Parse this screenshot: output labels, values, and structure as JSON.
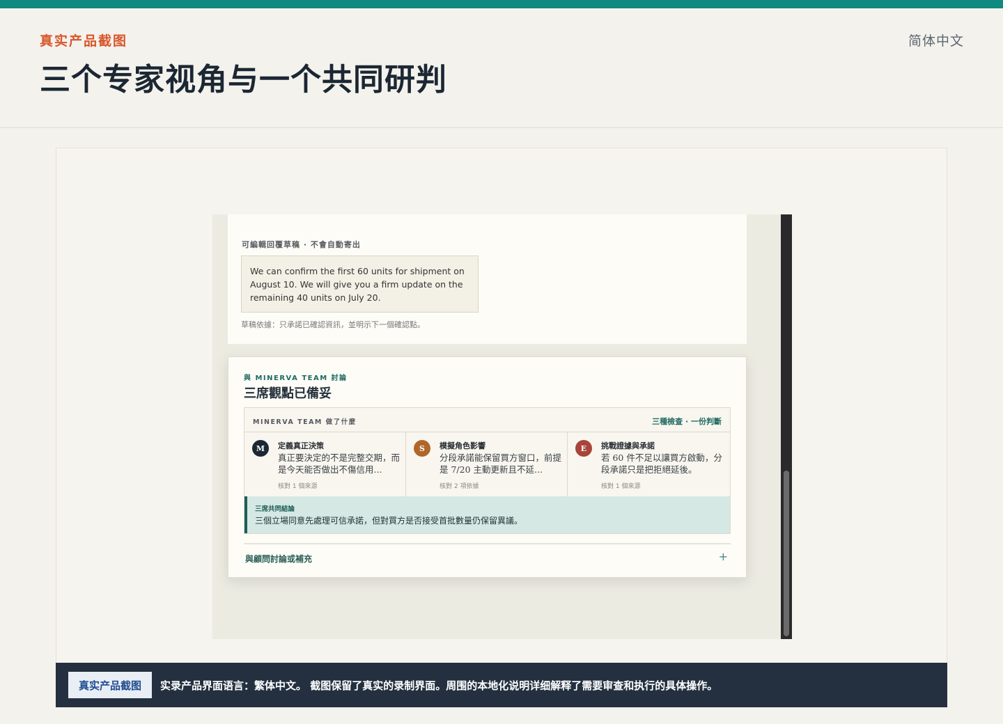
{
  "header": {
    "eyebrow": "真实产品截图",
    "title": "三个专家视角与一个共同研判",
    "language_switch": "简体中文"
  },
  "screenshot": {
    "draft_card": {
      "label": "可編輯回覆草稿 · 不會自動寄出",
      "draft_text": "We can confirm the first 60 units for shipment on August 10. We will give you a firm update on the remaining 40 units on July 20.",
      "note": "草稿依據：只承諾已確認資訊，並明示下一個確認點。"
    },
    "team_card": {
      "eyebrow": "與 MINERVA TEAM 討論",
      "title": "三席觀點已備妥",
      "panel_left": "MINERVA TEAM 做了什麼",
      "panel_right": "三種檢查 · 一份判斷",
      "perspectives": [
        {
          "initial": "M",
          "color": "#1c2733",
          "title": "定義真正決策",
          "body": "真正要決定的不是完整交期，而是今天能否做出不傷信用...",
          "meta": "核對 1 個來源"
        },
        {
          "initial": "S",
          "color": "#b0662a",
          "title": "模擬角色影響",
          "body": "分段承諾能保留買方窗口，前提是 7/20 主動更新且不延...",
          "meta": "核對 2 項依據"
        },
        {
          "initial": "E",
          "color": "#a8443a",
          "title": "挑戰證據與承諾",
          "body": "若 60 件不足以讓買方啟動，分段承諾只是把拒絕延後。",
          "meta": "核對 1 個來源"
        }
      ],
      "consensus_label": "三席共同結論",
      "consensus_text": "三個立場同意先處理可信承諾，但對買方是否接受首批數量仍保留異議。",
      "discuss_label": "與顧問討論或補充",
      "discuss_plus": "+"
    }
  },
  "caption": {
    "badge": "真实产品截图",
    "text": "实录产品界面语言：繁体中文。 截图保留了真实的录制界面。周围的本地化说明详细解释了需要审查和执行的具体操作。"
  },
  "colors": {
    "accent_teal": "#0f8a80",
    "eyebrow_orange": "#d8562c",
    "caption_bg": "#243040"
  }
}
